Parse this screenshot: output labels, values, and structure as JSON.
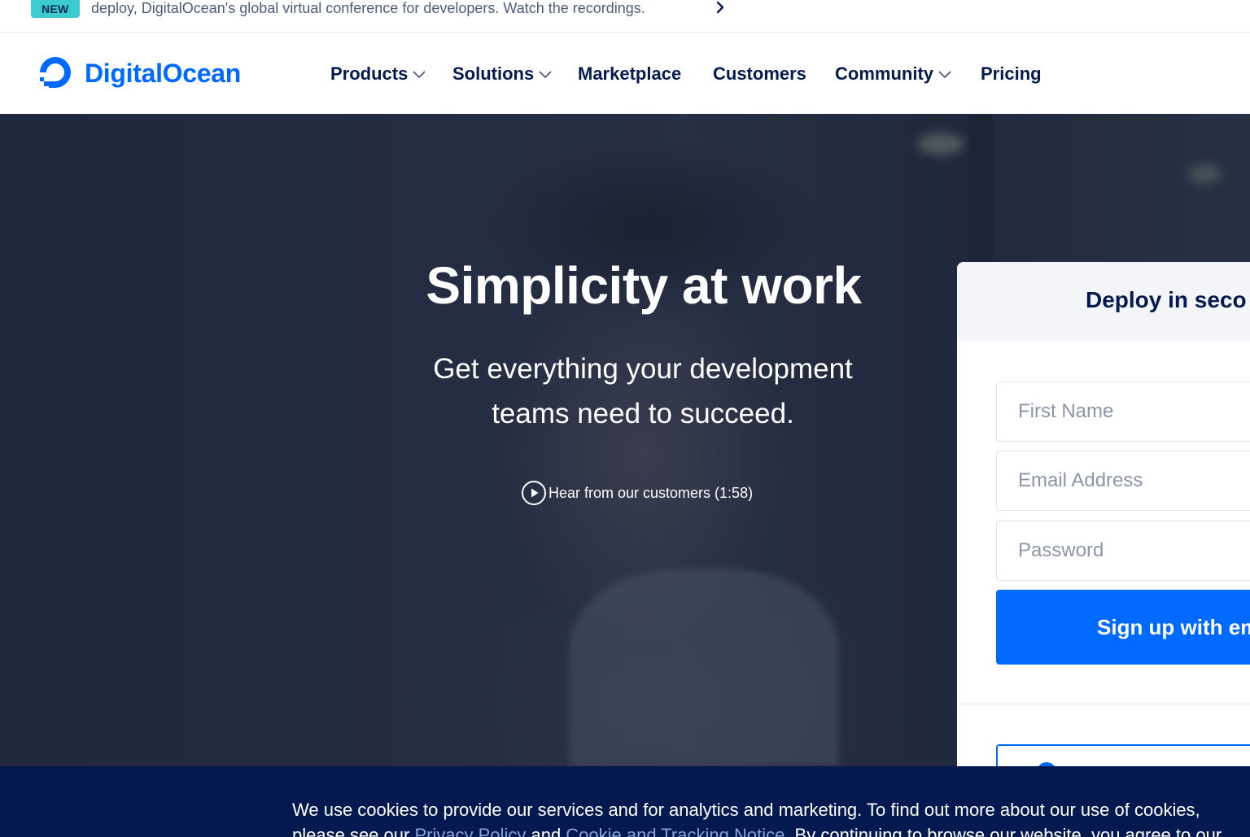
{
  "announcement": {
    "badge": "NEW",
    "message": "deploy, DigitalOcean's global virtual conference for developers. Watch the recordings.",
    "chevron_icon": "chevron-right-icon"
  },
  "nav": {
    "brand": "DigitalOcean",
    "logo_icon": "digitalocean-logo-icon",
    "items": [
      {
        "label": "Products",
        "dropdown": true
      },
      {
        "label": "Solutions",
        "dropdown": true
      },
      {
        "label": "Marketplace",
        "dropdown": false
      },
      {
        "label": "Customers",
        "dropdown": false
      },
      {
        "label": "Community",
        "dropdown": true
      },
      {
        "label": "Pricing",
        "dropdown": false
      }
    ]
  },
  "hero": {
    "title": "Simplicity at work",
    "subtitle": "Get everything your development teams need to succeed.",
    "video_link": "Hear from our customers (1:58)",
    "play_icon": "play-circle-icon"
  },
  "signup": {
    "title": "Deploy in seco",
    "first_name_placeholder": "First Name",
    "email_placeholder": "Email Address",
    "password_placeholder": "Password",
    "button_label": "Sign up with em"
  },
  "cookie": {
    "line1": "We use cookies to provide our services and for analytics and marketing. To find out more about our use of cookies,",
    "line2_prefix": "please see our ",
    "privacy_link": "Privacy Policy",
    "and": " and ",
    "cookie_link": "Cookie and Tracking Notice",
    "line2_suffix": ". By continuing to browse our website, you agree to our"
  },
  "colors": {
    "brand_blue": "#0069ff",
    "navy": "#031b4e",
    "cookie_bg": "#03194f",
    "badge_teal": "#3ccbcf"
  }
}
